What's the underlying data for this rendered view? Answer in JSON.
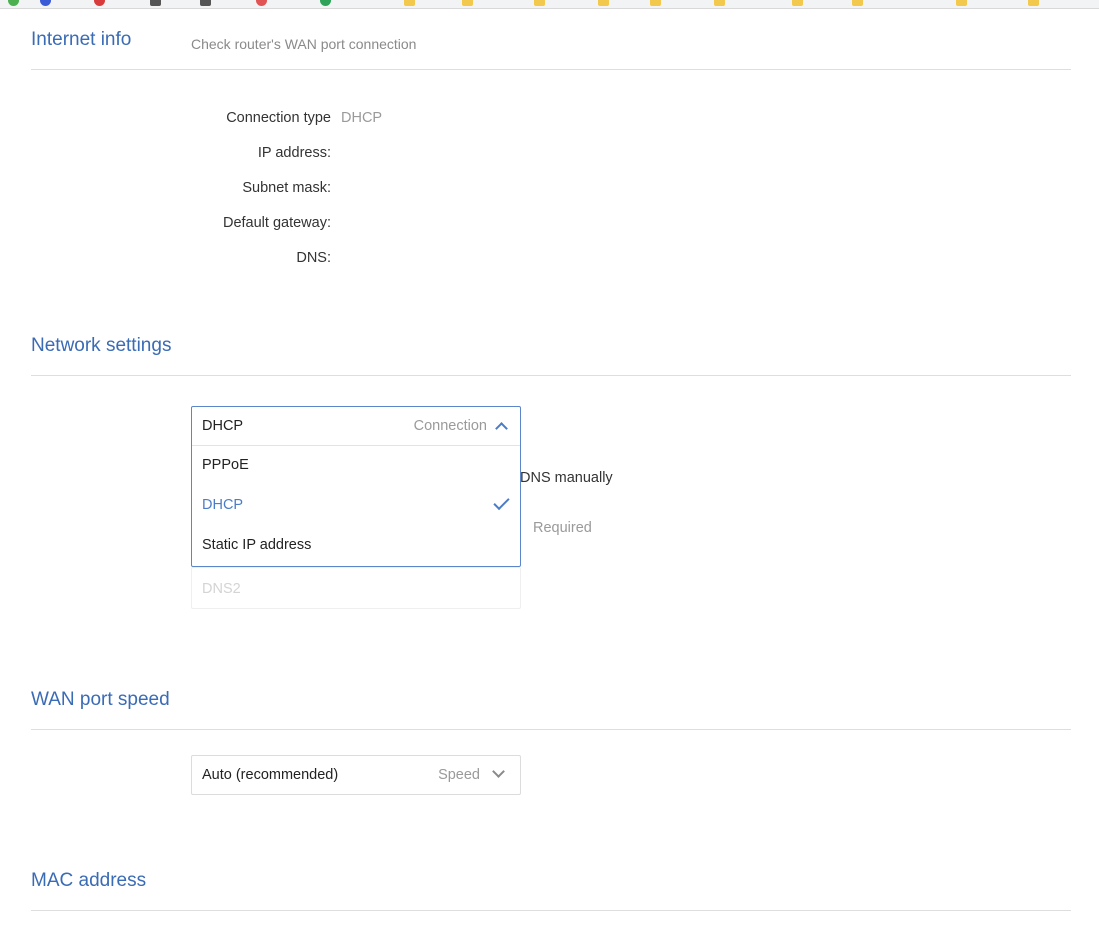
{
  "internet_info": {
    "title": "Internet info",
    "description": "Check router's WAN port connection",
    "rows": [
      {
        "label": "Connection type",
        "value": "DHCP"
      },
      {
        "label": "IP address:",
        "value": ""
      },
      {
        "label": "Subnet mask:",
        "value": ""
      },
      {
        "label": "Default gateway:",
        "value": ""
      },
      {
        "label": "DNS:",
        "value": ""
      }
    ]
  },
  "network_settings": {
    "title": "Network settings",
    "connection_select": {
      "value": "DHCP",
      "placeholder": "Connection",
      "expanded": true
    },
    "options": [
      {
        "label": "PPPoE",
        "selected": false
      },
      {
        "label": "DHCP",
        "selected": true
      },
      {
        "label": "Static IP address",
        "selected": false
      }
    ],
    "dns_manual_label_partial": "DNS manually",
    "dns1_required_hint": "Required",
    "dns2_placeholder": "DNS2"
  },
  "wan_port_speed": {
    "title": "WAN port speed",
    "speed_select": {
      "value": "Auto (recommended)",
      "placeholder": "Speed"
    }
  },
  "mac_address": {
    "title": "MAC address"
  },
  "colors": {
    "accent": "#3a6bb5",
    "selected": "#4a7dc9",
    "muted": "#9a9a9a",
    "divider": "#dedede"
  }
}
